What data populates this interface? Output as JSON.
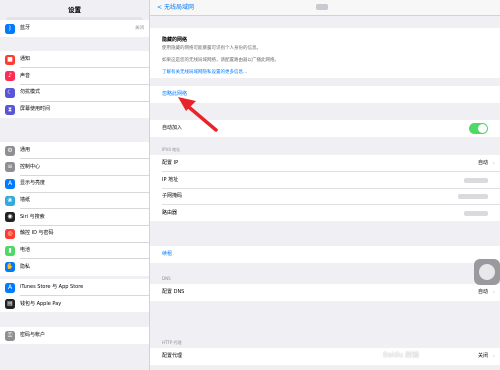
{
  "sidebar": {
    "title": "设置",
    "groups": [
      [
        {
          "label": "蓝牙",
          "value": "关闭",
          "icon": "bluetooth-icon",
          "color": "#007aff",
          "glyph": "ᛒ"
        }
      ],
      [
        {
          "label": "通知",
          "icon": "notifications-icon",
          "color": "#ff3b30",
          "glyph": "■"
        },
        {
          "label": "声音",
          "icon": "sound-icon",
          "color": "#ff2d55",
          "glyph": "♪"
        },
        {
          "label": "勿扰模式",
          "icon": "moon-icon",
          "color": "#5856d6",
          "glyph": "☾"
        },
        {
          "label": "屏幕使用时间",
          "icon": "hourglass-icon",
          "color": "#5856d6",
          "glyph": "⧗"
        }
      ],
      [
        {
          "label": "通用",
          "icon": "gear-icon",
          "color": "#8e8e93",
          "glyph": "⚙"
        },
        {
          "label": "控制中心",
          "icon": "control-center-icon",
          "color": "#8e8e93",
          "glyph": "≡"
        },
        {
          "label": "显示与亮度",
          "icon": "display-icon",
          "color": "#007aff",
          "glyph": "A"
        },
        {
          "label": "墙纸",
          "icon": "wallpaper-icon",
          "color": "#34aadc",
          "glyph": "❀"
        },
        {
          "label": "Siri 与搜索",
          "icon": "siri-icon",
          "color": "#222222",
          "glyph": "◉"
        },
        {
          "label": "触控 ID 与密码",
          "icon": "fingerprint-icon",
          "color": "#ff3b30",
          "glyph": "◎"
        },
        {
          "label": "电池",
          "icon": "battery-icon",
          "color": "#4cd964",
          "glyph": "▮"
        },
        {
          "label": "隐私",
          "icon": "hand-icon",
          "color": "#007aff",
          "glyph": "✋"
        }
      ],
      [
        {
          "label": "iTunes Store 与 App Store",
          "icon": "appstore-icon",
          "color": "#007aff",
          "glyph": "A"
        },
        {
          "label": "钱包与 Apple Pay",
          "icon": "wallet-icon",
          "color": "#222222",
          "glyph": "▤"
        }
      ],
      [
        {
          "label": "密码与帐户",
          "icon": "key-icon",
          "color": "#8e8e93",
          "glyph": "⚿"
        }
      ]
    ]
  },
  "nav": {
    "back_label": "无线局域网"
  },
  "hidden_network": {
    "title": "隐藏的网络",
    "line1": "使用隐藏的网络可能暴露可识别个人身份的信息。",
    "line2": "如果这是您的无线局域网络，请配置路由器以广播此网络。",
    "link": "了解有关无线局域网隐私设置的更多信息…"
  },
  "forget_label": "忽略此网络",
  "auto_join": {
    "label": "自动加入",
    "on": true
  },
  "ipv4": {
    "header": "IPV4 地址",
    "rows": [
      {
        "label": "配置 IP",
        "value": "自动",
        "chevron": true
      },
      {
        "label": "IP 地址",
        "value": null
      },
      {
        "label": "子网掩码",
        "value": null
      },
      {
        "label": "路由器",
        "value": null
      }
    ]
  },
  "renew_label": "续租",
  "dns": {
    "header": "DNS",
    "label": "配置 DNS",
    "value": "自动"
  },
  "proxy": {
    "header": "HTTP 代理",
    "label": "配置代理",
    "value": "关闭"
  },
  "watermark": "Baidu 经验"
}
